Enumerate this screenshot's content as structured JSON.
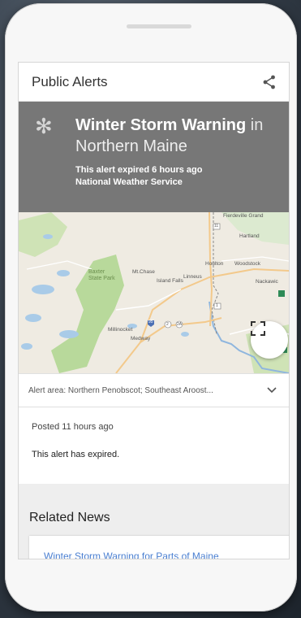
{
  "card": {
    "title": "Public Alerts",
    "icons": {
      "share": "share-icon",
      "alert": "snowflake-icon"
    }
  },
  "alert": {
    "event": "Winter Storm Warning",
    "connector": "in",
    "region": "Northern Maine",
    "expired_text": "This alert expired 6 hours ago",
    "source": "National Weather Service",
    "banner_color": "#777777"
  },
  "map": {
    "labels": {
      "fierdown": "Fierdeville Grand",
      "hartland": "Hartland",
      "baxter": "Baxter\nState Park",
      "mtchase": "Mt.Chase",
      "island_falls": "Island Falls",
      "linneus": "Linneus",
      "houlton": "Houlton",
      "woodstock": "Woodstock",
      "nackawic": "Nackawic",
      "millinocket": "Millinocket",
      "medway": "Medway",
      "route_11": "11",
      "route_95": "95",
      "route_2": "2",
      "route_2a": "2A",
      "route_1": "1"
    }
  },
  "alert_area": {
    "text": "Alert area: Northern Penobscot; Southeast Aroost...",
    "icon": "chevron-down-icon"
  },
  "posted": "Posted 11 hours ago",
  "status_note": "This alert has expired.",
  "related_news": {
    "heading": "Related News",
    "first_headline": "Winter Storm Warning for Parts of Maine"
  },
  "colors": {
    "link": "#4a7fd1",
    "park_green": "#b8d99b",
    "water": "#a9cbe8"
  }
}
